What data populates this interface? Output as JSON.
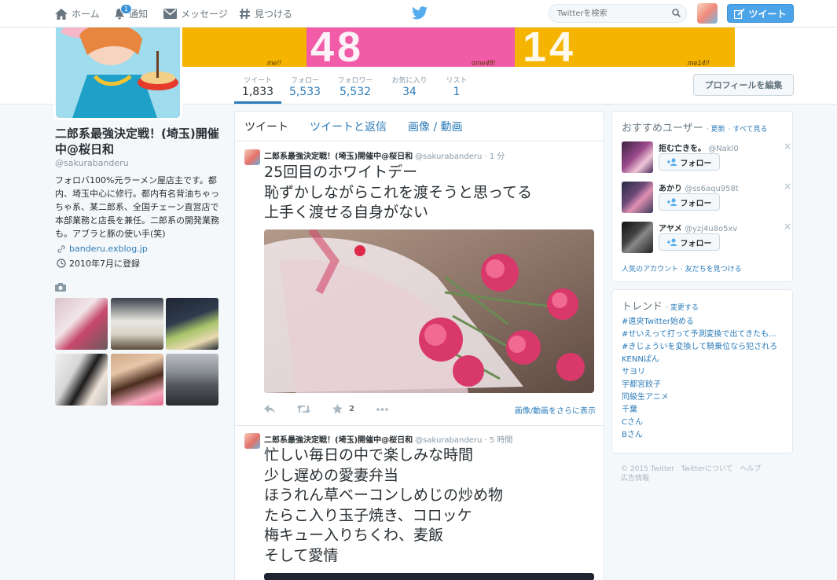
{
  "nav": {
    "home": "ホーム",
    "notifications": "通知",
    "notifications_count": "1",
    "messages": "メッセージ",
    "discover": "見つける",
    "search_placeholder": "Twitterを検索",
    "tweet_button": "ツイート"
  },
  "banner": {
    "text_48": "48",
    "text_14": "14",
    "small_left": "me!!",
    "small_mid": "ome48!",
    "small_right": "me14!!"
  },
  "stats": {
    "tweets_label": "ツイート",
    "tweets": "1,833",
    "following_label": "フォロー",
    "following": "5,533",
    "followers_label": "フォロワー",
    "followers": "5,532",
    "favorites_label": "お気に入り",
    "favorites": "34",
    "lists_label": "リスト",
    "lists": "1"
  },
  "edit_profile": "プロフィールを編集",
  "profile": {
    "name": "二郎系最強決定戦！(埼玉)開催中@桜日和",
    "handle": "@sakurabanderu",
    "bio": "フォロバ100%元ラーメン屋店主です。都内、埼玉中心に修行。都内有名背油ちゃっちゃ系、某二郎系、全国チェーン直営店で本部業務と店長を兼任。二郎系の開発業務も。アブラと豚の使い手(笑)",
    "url": "banderu.exblog.jp",
    "joined": "2010年7月に登録"
  },
  "timeline": {
    "tabs": [
      "ツイート",
      "ツイートと返信",
      "画像 / 動画"
    ],
    "tweets": [
      {
        "name": "二郎系最強決定戦！(埼玉)開催中@桜日和",
        "handle": "@sakurabanderu",
        "time": "· 1 分",
        "lines": [
          "25回目のホワイトデー",
          "恥ずかしながらこれを渡そうと思ってる",
          "上手く渡せる自身がない"
        ],
        "fav_count": "2",
        "more_media": "画像/動画をさらに表示"
      },
      {
        "name": "二郎系最強決定戦！(埼玉)開催中@桜日和",
        "handle": "@sakurabanderu",
        "time": "· 5 時間",
        "lines": [
          "忙しい毎日の中で楽しみな時間",
          "少し遅めの愛妻弁当",
          "ほうれん草ベーコンしめじの炒め物",
          "たらこ入り玉子焼き、コロッケ",
          "梅キュー入りちくわ、麦飯",
          "そして愛情"
        ]
      }
    ]
  },
  "who_to_follow": {
    "title": "おすすめユーザー",
    "refresh": "· 更新",
    "view_all": "· すべて見る",
    "follow_label": "フォロー",
    "users": [
      {
        "name": "拒む亡きを。",
        "handle": "@Nakl0"
      },
      {
        "name": "あかり",
        "handle": "@ss6aqu958t"
      },
      {
        "name": "アヤメ",
        "handle": "@yzj4u8o5xv"
      }
    ],
    "footer": "人気のアカウント · 友だちを見つける"
  },
  "trends": {
    "title": "トレンド",
    "change": "· 変更する",
    "items": [
      "#遠央Twitter始める",
      "#せいえって打って予測変換で出てきたも...",
      "#きじょういを変換して騎乗位なら犯されろ",
      "KENNぱん",
      "サヨリ",
      "宇都宮餃子",
      "同級生アニメ",
      "千葉",
      "Cさん",
      "Bさん"
    ]
  },
  "footer": {
    "copyright": "© 2015 Twitter",
    "about": "Twitterについて",
    "help": "ヘルプ",
    "ads": "広告情報"
  },
  "colors": {
    "accent": "#2b7bb9",
    "tweet_button": "#4ca4e8",
    "banner_yellow": "#f5b400",
    "banner_pink": "#f25ba8"
  }
}
